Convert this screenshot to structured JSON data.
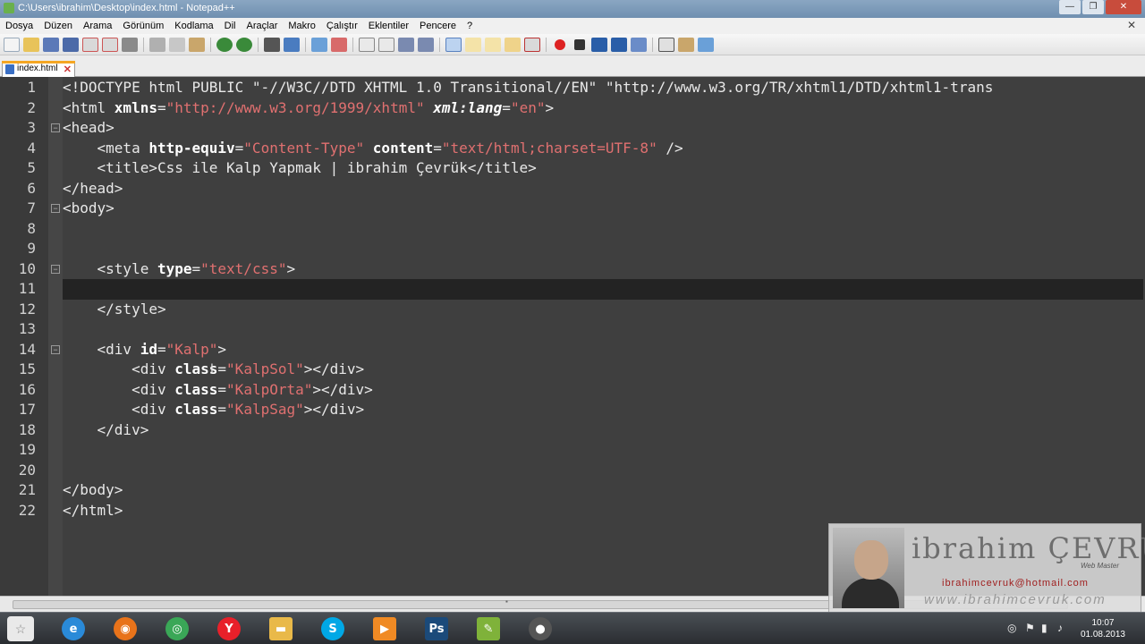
{
  "window": {
    "title": "C:\\Users\\ibrahim\\Desktop\\index.html - Notepad++",
    "minimize": "—",
    "maximize": "❐",
    "close": "✕"
  },
  "menu": {
    "items": [
      "Dosya",
      "Düzen",
      "Arama",
      "Görünüm",
      "Kodlama",
      "Dil",
      "Araçlar",
      "Makro",
      "Çalıştır",
      "Eklentiler",
      "Pencere",
      "?"
    ],
    "close_glyph": "✕"
  },
  "tab": {
    "label": "index.html",
    "close_glyph": "✕"
  },
  "editor": {
    "lines": [
      {
        "n": "1",
        "parts": [
          [
            "t-tag",
            "<!DOCTYPE html PUBLIC \"-//W3C//DTD XHTML 1.0 Transitional//EN\" \"http://www.w3.org/TR/xhtml1/DTD/xhtml1-trans"
          ]
        ]
      },
      {
        "n": "2",
        "parts": [
          [
            "t-tag",
            "<html "
          ],
          [
            "t-attr",
            "xmlns"
          ],
          [
            "t-tag",
            "="
          ],
          [
            "t-str",
            "\"http://www.w3.org/1999/xhtml\""
          ],
          [
            "t-tag",
            " "
          ],
          [
            "t-italic",
            "xml:lang"
          ],
          [
            "t-tag",
            "="
          ],
          [
            "t-str",
            "\"en\""
          ],
          [
            "t-tag",
            ">"
          ]
        ]
      },
      {
        "n": "3",
        "parts": [
          [
            "t-tag",
            "<head>"
          ]
        ]
      },
      {
        "n": "4",
        "parts": [
          [
            "t-tag",
            "    <meta "
          ],
          [
            "t-attr",
            "http-equiv"
          ],
          [
            "t-tag",
            "="
          ],
          [
            "t-str",
            "\"Content-Type\""
          ],
          [
            "t-tag",
            " "
          ],
          [
            "t-attr",
            "content"
          ],
          [
            "t-tag",
            "="
          ],
          [
            "t-str",
            "\"text/html;charset=UTF-8\""
          ],
          [
            "t-tag",
            " />"
          ]
        ]
      },
      {
        "n": "5",
        "parts": [
          [
            "t-tag",
            "    <title>Css ile Kalp Yapmak | ibrahim Çevrük</title>"
          ]
        ]
      },
      {
        "n": "6",
        "parts": [
          [
            "t-tag",
            "</head>"
          ]
        ]
      },
      {
        "n": "7",
        "parts": [
          [
            "t-tag",
            "<body>"
          ]
        ]
      },
      {
        "n": "8",
        "parts": [
          [
            "t-tag",
            ""
          ]
        ]
      },
      {
        "n": "9",
        "parts": [
          [
            "t-tag",
            ""
          ]
        ]
      },
      {
        "n": "10",
        "parts": [
          [
            "t-tag",
            "    <style "
          ],
          [
            "t-attr",
            "type"
          ],
          [
            "t-tag",
            "="
          ],
          [
            "t-str",
            "\"text/css\""
          ],
          [
            "t-tag",
            ">"
          ]
        ]
      },
      {
        "n": "11",
        "parts": [
          [
            "t-tag",
            ""
          ]
        ]
      },
      {
        "n": "12",
        "parts": [
          [
            "t-tag",
            "    </style>"
          ]
        ]
      },
      {
        "n": "13",
        "parts": [
          [
            "t-tag",
            ""
          ]
        ]
      },
      {
        "n": "14",
        "parts": [
          [
            "t-tag",
            "    <div "
          ],
          [
            "t-attr",
            "id"
          ],
          [
            "t-tag",
            "="
          ],
          [
            "t-str",
            "\"Kalp\""
          ],
          [
            "t-tag",
            ">"
          ]
        ]
      },
      {
        "n": "15",
        "parts": [
          [
            "t-tag",
            "        <div "
          ],
          [
            "t-attr",
            "class"
          ],
          [
            "t-tag",
            "="
          ],
          [
            "t-str",
            "\"KalpSol\""
          ],
          [
            "t-tag",
            "></div>"
          ]
        ]
      },
      {
        "n": "16",
        "parts": [
          [
            "t-tag",
            "        <div "
          ],
          [
            "t-attr",
            "class"
          ],
          [
            "t-tag",
            "="
          ],
          [
            "t-str",
            "\"KalpOrta\""
          ],
          [
            "t-tag",
            "></div>"
          ]
        ]
      },
      {
        "n": "17",
        "parts": [
          [
            "t-tag",
            "        <div "
          ],
          [
            "t-attr",
            "class"
          ],
          [
            "t-tag",
            "="
          ],
          [
            "t-str",
            "\"KalpSag\""
          ],
          [
            "t-tag",
            "></div>"
          ]
        ]
      },
      {
        "n": "18",
        "parts": [
          [
            "t-tag",
            "    </div>"
          ]
        ]
      },
      {
        "n": "19",
        "parts": [
          [
            "t-tag",
            ""
          ]
        ]
      },
      {
        "n": "20",
        "parts": [
          [
            "t-tag",
            ""
          ]
        ]
      },
      {
        "n": "21",
        "parts": [
          [
            "t-tag",
            "</body>"
          ]
        ]
      },
      {
        "n": "22",
        "parts": [
          [
            "t-tag",
            "</html>"
          ]
        ]
      }
    ],
    "current_line": "11",
    "fold_lines": [
      "3",
      "7",
      "10",
      "14"
    ]
  },
  "watermark": {
    "name": "ibrahim ÇEVRÜK",
    "role": "Web Master",
    "email": "ibrahimcevruk@hotmail.com",
    "site": "www.ibrahimcevruk.com"
  },
  "taskbar": {
    "apps": [
      {
        "name": "ie-icon",
        "glyph": "e",
        "color": "#2a8ad8"
      },
      {
        "name": "firefox-icon",
        "glyph": "◉",
        "color": "#e8731a"
      },
      {
        "name": "chrome-icon",
        "glyph": "◎",
        "color": "#3aa757"
      },
      {
        "name": "yandex-icon",
        "glyph": "Y",
        "color": "#e8202a"
      },
      {
        "name": "folder-icon",
        "glyph": "▬",
        "color": "#e9b949"
      },
      {
        "name": "skype-icon",
        "glyph": "S",
        "color": "#00a8e6"
      },
      {
        "name": "media-icon",
        "glyph": "▶",
        "color": "#f08a24"
      },
      {
        "name": "photoshop-icon",
        "glyph": "Ps",
        "color": "#1b4a7a"
      },
      {
        "name": "notepadpp-icon",
        "glyph": "✎",
        "color": "#7fb23a"
      },
      {
        "name": "camtasia-icon",
        "glyph": "●",
        "color": "#555555"
      }
    ],
    "time": "10:07",
    "date": "01.08.2013"
  }
}
